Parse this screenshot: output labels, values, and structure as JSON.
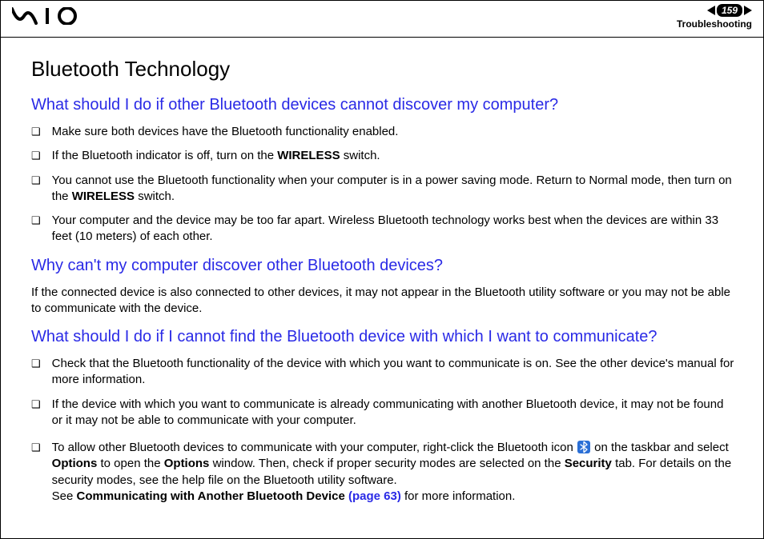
{
  "header": {
    "logo_text": "VAIO",
    "page_number": "159",
    "section": "Troubleshooting"
  },
  "content": {
    "title": "Bluetooth Technology",
    "sections": [
      {
        "question": "What should I do if other Bluetooth devices cannot discover my computer?",
        "bullets": [
          {
            "pre": "Make sure both devices have the Bluetooth functionality enabled."
          },
          {
            "pre": "If the Bluetooth indicator is off, turn on the ",
            "bold1": "WIRELESS",
            "post1": " switch."
          },
          {
            "pre": "You cannot use the Bluetooth functionality when your computer is in a power saving mode. Return to Normal mode, then turn on the ",
            "bold1": "WIRELESS",
            "post1": " switch."
          },
          {
            "pre": "Your computer and the device may be too far apart. Wireless Bluetooth technology works best when the devices are within 33 feet (10 meters) of each other."
          }
        ]
      },
      {
        "question": "Why can't my computer discover other Bluetooth devices?",
        "paragraph": "If the connected device is also connected to other devices, it may not appear in the Bluetooth utility software or you may not be able to communicate with the device."
      },
      {
        "question": "What should I do if I cannot find the Bluetooth device with which I want to communicate?",
        "bullets": [
          {
            "pre": "Check that the Bluetooth functionality of the device with which you want to communicate is on. See the other device's manual for more information."
          },
          {
            "pre": "If the device with which you want to communicate is already communicating with another Bluetooth device, it may not be found or it may not be able to communicate with your computer."
          }
        ],
        "bullets2": [
          {
            "pre": "To allow other Bluetooth devices to communicate with your computer, right-click the Bluetooth icon ",
            "icon": true,
            "postIcon": " on the taskbar and select ",
            "bold1": "Options",
            "post1": " to open the ",
            "bold2": "Options",
            "post2": " window. Then, check if proper security modes are selected on the ",
            "bold3": "Security",
            "post3": " tab. For details on the security modes, see the help file on the Bluetooth utility software.",
            "br": true,
            "pre2": "See ",
            "bold4": "Communicating with Another Bluetooth Device ",
            "link": "(page 63)",
            "post4": " for more information."
          }
        ]
      }
    ]
  }
}
